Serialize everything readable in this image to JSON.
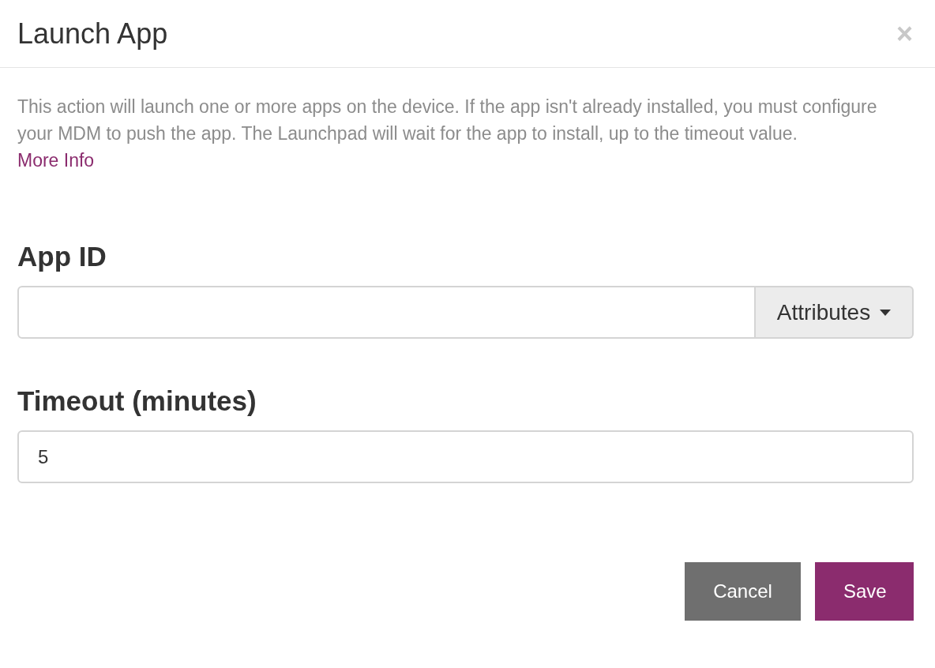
{
  "dialog": {
    "title": "Launch App",
    "close": "×"
  },
  "description": "This action will launch one or more apps on the device. If the app isn't already installed, you must configure your MDM to push the app. The Launchpad will wait for the app to install, up to the timeout value.",
  "more_info_link": "More Info",
  "fields": [
    {
      "kind": "addon",
      "label": "App ID",
      "addon": "Attributes"
    },
    {
      "kind": "plain",
      "label": "Timeout (minutes)",
      "value": "5"
    }
  ],
  "buttons": [
    {
      "label": "Cancel",
      "kind": "secondary"
    },
    {
      "label": "Save",
      "kind": "primary"
    }
  ]
}
